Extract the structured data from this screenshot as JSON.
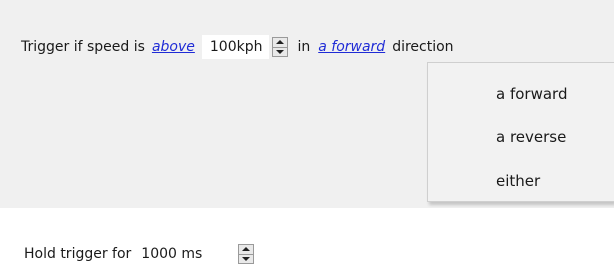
{
  "trigger": {
    "prefix": "Trigger if speed is",
    "comparison_link": "above",
    "speed_value": "100kph",
    "in_label": "in",
    "direction_link": "a forward",
    "suffix": "direction"
  },
  "direction_menu": {
    "items": [
      {
        "label": "a forward"
      },
      {
        "label": "a reverse"
      },
      {
        "label": "either"
      }
    ]
  },
  "hold": {
    "label": "Hold trigger for",
    "value": "1000 ms"
  },
  "colors": {
    "panel": "#f0f0f0",
    "link": "#1f2bd6"
  },
  "icons": {
    "spinner_up": "triangle-up",
    "spinner_down": "triangle-down"
  }
}
